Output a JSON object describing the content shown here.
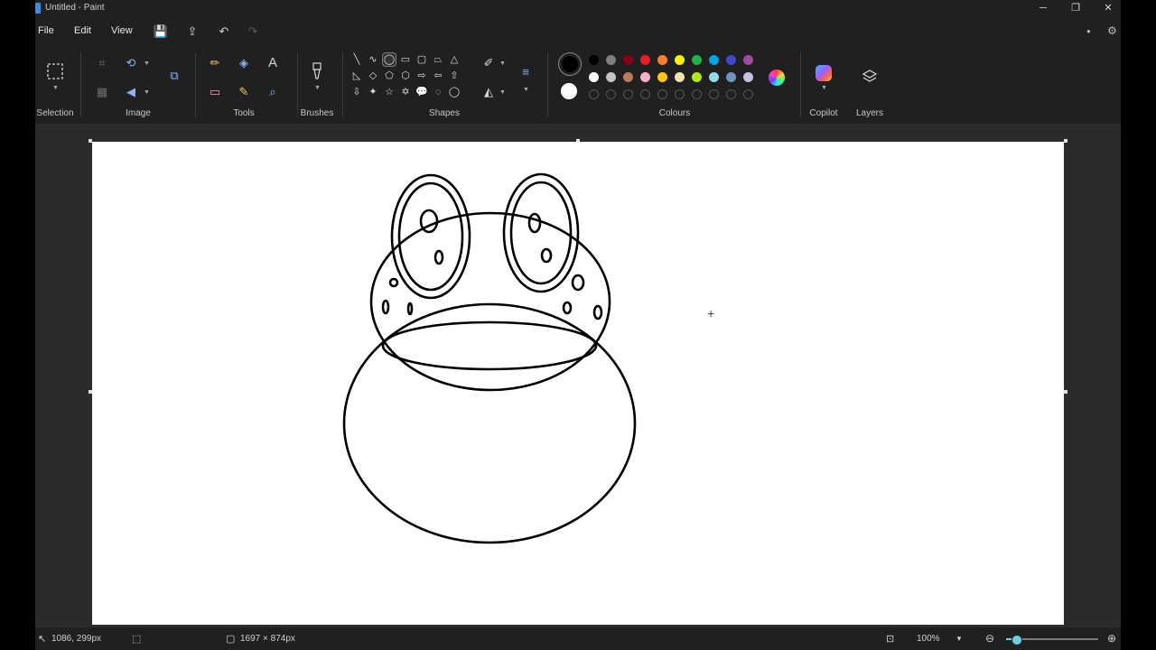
{
  "window": {
    "title": "Untitled - Paint",
    "controls": {
      "minimize": "─",
      "restore": "❐",
      "close": "✕"
    }
  },
  "menu": {
    "file": "File",
    "edit": "Edit",
    "view": "View",
    "quick_actions": {
      "save_icon": "💾",
      "share_icon": "⇪",
      "undo_icon": "↶",
      "redo_icon": "↷"
    },
    "right_icons": {
      "account_icon": "●",
      "settings_icon": "⚙"
    }
  },
  "ribbon": {
    "groups": {
      "selection": "Selection",
      "image": "Image",
      "tools": "Tools",
      "brushes": "Brushes",
      "shapes": "Shapes",
      "colours": "Colours",
      "copilot": "Copilot",
      "layers": "Layers"
    },
    "tools": {
      "pencil": "✏",
      "fill": "◈",
      "text": "A",
      "eraser": "▭",
      "picker": "✎",
      "magnifier": "⌕"
    },
    "shapes": [
      "╲",
      "∿",
      "◯",
      "▭",
      "▢",
      "⏢",
      "△",
      "◺",
      "◇",
      "⬠",
      "⬡",
      "⇨",
      "⇦",
      "⇧",
      "⇩",
      "✦",
      "☆",
      "✡",
      "💬",
      "◌",
      "◯"
    ],
    "colours": {
      "primary": "#000000",
      "secondary": "#ffffff",
      "row1": [
        "#000000",
        "#7f7f7f",
        "#880015",
        "#ed1c24",
        "#ff7f27",
        "#fff200",
        "#22b14c",
        "#00a2e8",
        "#3f48cc",
        "#a349a4"
      ],
      "row2": [
        "#ffffff",
        "#c3c3c3",
        "#b97a57",
        "#ffaec9",
        "#ffc90e",
        "#efe4b0",
        "#b5e61d",
        "#99d9ea",
        "#7092be",
        "#c8bfe7"
      ],
      "empty_slots": 10
    }
  },
  "status": {
    "cursor_position": "1086, 299px",
    "canvas_size": "1697 × 874px",
    "zoom": "100%",
    "zoom_slider_fraction": 0.12
  }
}
